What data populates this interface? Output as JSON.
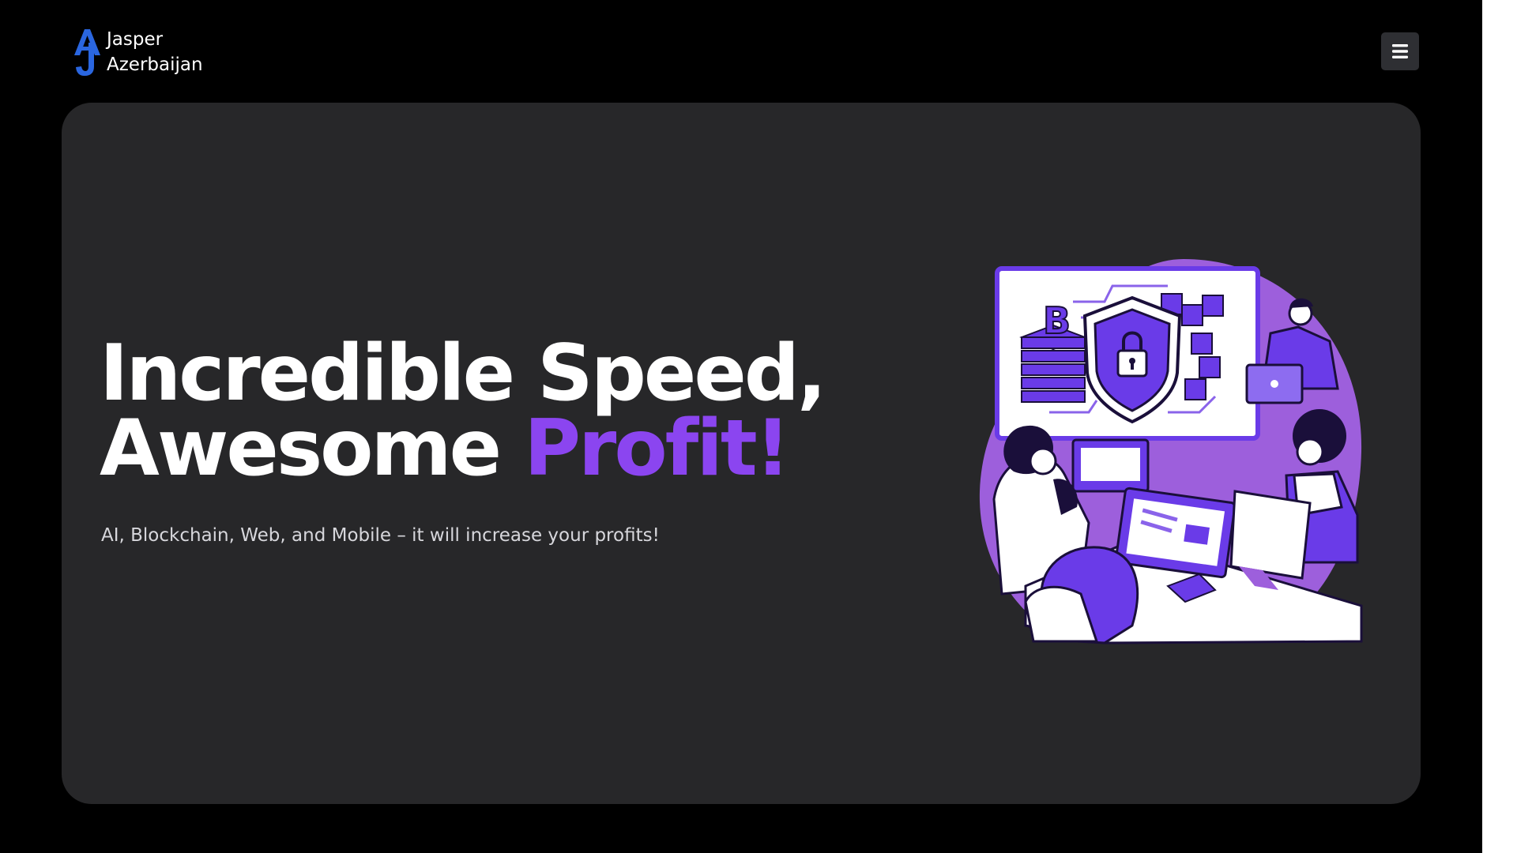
{
  "brand": {
    "name_line1": "Jasper",
    "name_line2": "Azerbaijan",
    "logo_icon": "aj-monogram-logo",
    "logo_color": "#2a66e0"
  },
  "header": {
    "menu_icon": "hamburger-menu-icon"
  },
  "hero": {
    "headline_line1": "Incredible Speed,",
    "headline_line2_prefix": "Awesome ",
    "headline_line2_accent": "Profit!",
    "subtitle": "AI, Blockchain, Web, and Mobile – it will increase your profits!",
    "illustration": "team-working-on-blockchain-security-illustration",
    "accent_color": "#8b45f0"
  },
  "colors": {
    "page_background": "#000000",
    "card_background": "#272729",
    "text_primary": "#ffffff",
    "text_secondary": "#d7d7dc",
    "illustration_purple": "#6a3be8",
    "illustration_blob": "#9d5fdc"
  }
}
